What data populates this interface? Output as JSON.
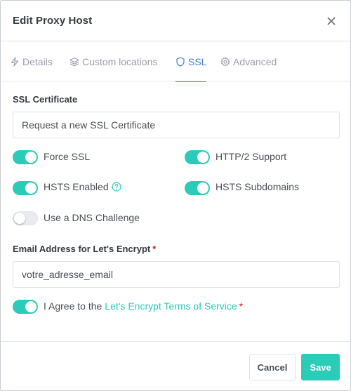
{
  "modal": {
    "title": "Edit Proxy Host",
    "close_icon": "close-icon"
  },
  "tabs": [
    {
      "label": "Details",
      "icon": "bolt-icon",
      "active": false
    },
    {
      "label": "Custom locations",
      "icon": "layers-icon",
      "active": false
    },
    {
      "label": "SSL",
      "icon": "shield-icon",
      "active": true
    },
    {
      "label": "Advanced",
      "icon": "gear-icon",
      "active": false
    }
  ],
  "ssl": {
    "certificate_label": "SSL Certificate",
    "certificate_value": "Request a new SSL Certificate",
    "toggles": {
      "force_ssl": {
        "label": "Force SSL",
        "on": true
      },
      "http2": {
        "label": "HTTP/2 Support",
        "on": true
      },
      "hsts_enabled": {
        "label": "HSTS Enabled",
        "on": true
      },
      "hsts_subdomains": {
        "label": "HSTS Subdomains",
        "on": true
      },
      "dns_challenge": {
        "label": "Use a DNS Challenge",
        "on": false
      }
    },
    "email_label": "Email Address for Let's Encrypt",
    "required_mark": "*",
    "email_value": "votre_adresse_email",
    "agree_label": "I Agree to the",
    "agree_link": "Let's Encrypt Terms of Service",
    "agree_on": true
  },
  "footer": {
    "cancel_label": "Cancel",
    "save_label": "Save"
  },
  "colors": {
    "accent": "#2bcbba",
    "tab_active": "#467fcf",
    "required": "#cd201f"
  }
}
